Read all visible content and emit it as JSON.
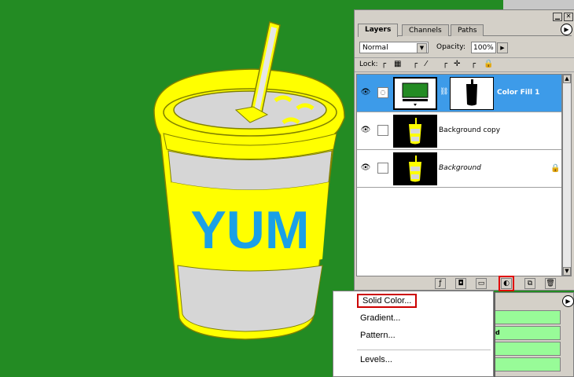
{
  "canvas": {
    "background": "#238b23",
    "cup_label": "YUM",
    "cup_colors": {
      "rim": "#ffff00",
      "body": "#d6d6d6",
      "label_text": "#1aa0e6"
    }
  },
  "layers_panel": {
    "tabs": [
      {
        "label": "Layers",
        "active": true
      },
      {
        "label": "Channels",
        "active": false
      },
      {
        "label": "Paths",
        "active": false
      }
    ],
    "blend_mode": "Normal",
    "opacity_label": "Opacity:",
    "opacity_value": "100%",
    "lock_label": "Lock:",
    "layers": [
      {
        "name": "Color Fill 1",
        "selected": true,
        "visible": true,
        "locked": false
      },
      {
        "name": "Background copy",
        "selected": false,
        "visible": true,
        "locked": false
      },
      {
        "name": "Background",
        "selected": false,
        "visible": true,
        "locked": true,
        "italic": true
      }
    ],
    "bottom_buttons": [
      "link-layers-icon",
      "layer-style-icon",
      "layer-mask-icon",
      "new-group-icon",
      "adjustment-layer-icon",
      "new-layer-icon",
      "trash-icon"
    ],
    "highlighted_button": "adjustment-layer-icon"
  },
  "fill_menu": {
    "items": [
      {
        "label": "Solid Color...",
        "highlighted": true
      },
      {
        "label": "Gradient...",
        "highlighted": false
      },
      {
        "label": "Pattern...",
        "highlighted": false
      },
      {
        "label": "Levels...",
        "highlighted": false
      }
    ]
  },
  "lower_panel": {
    "row_text": "d",
    "row_color": "#98fb98"
  },
  "colors": {
    "selection": "#3d9be9",
    "highlight_box": "#cc0000"
  }
}
